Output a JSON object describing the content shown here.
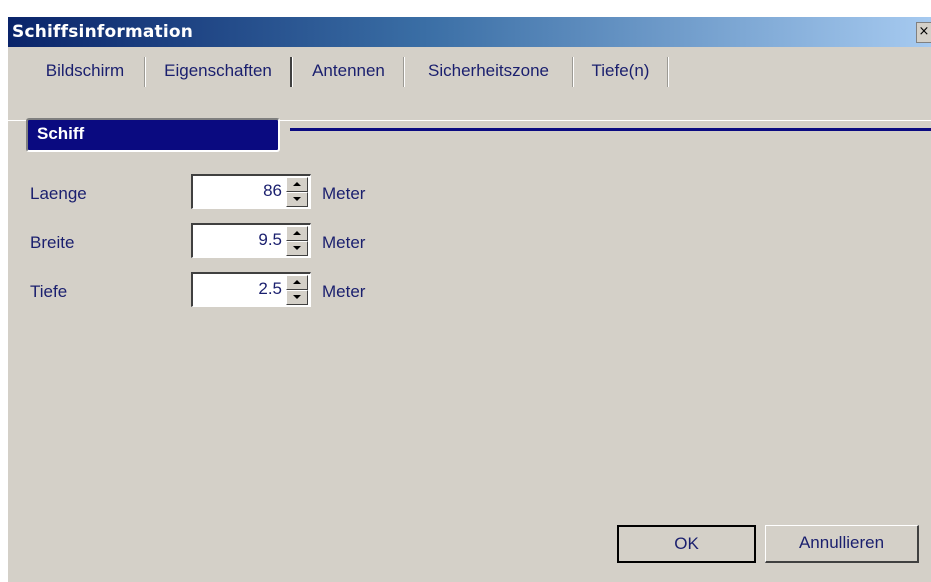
{
  "window": {
    "title": "Schiffsinformation",
    "close_glyph": "×"
  },
  "tabs": [
    {
      "label": "Bildschirm",
      "active": false
    },
    {
      "label": "Eigenschaften",
      "active": true
    },
    {
      "label": "Antennen",
      "active": false
    },
    {
      "label": "Sicherheitszone",
      "active": false
    },
    {
      "label": "Tiefe(n)",
      "active": false
    }
  ],
  "section": {
    "title": "Schiff"
  },
  "fields": [
    {
      "label": "Laenge",
      "value": "86",
      "unit": "Meter"
    },
    {
      "label": "Breite",
      "value": "9.5",
      "unit": "Meter"
    },
    {
      "label": "Tiefe",
      "value": "2.5",
      "unit": "Meter"
    }
  ],
  "buttons": {
    "ok": "OK",
    "cancel": "Annullieren"
  },
  "colors": {
    "section_header": "#0a0a80",
    "text": "#1a1f6e",
    "dialog": "#d4d0c8"
  },
  "icons": {
    "close": "close-icon",
    "spin_up": "spin-up-arrow-icon",
    "spin_down": "spin-down-arrow-icon"
  }
}
